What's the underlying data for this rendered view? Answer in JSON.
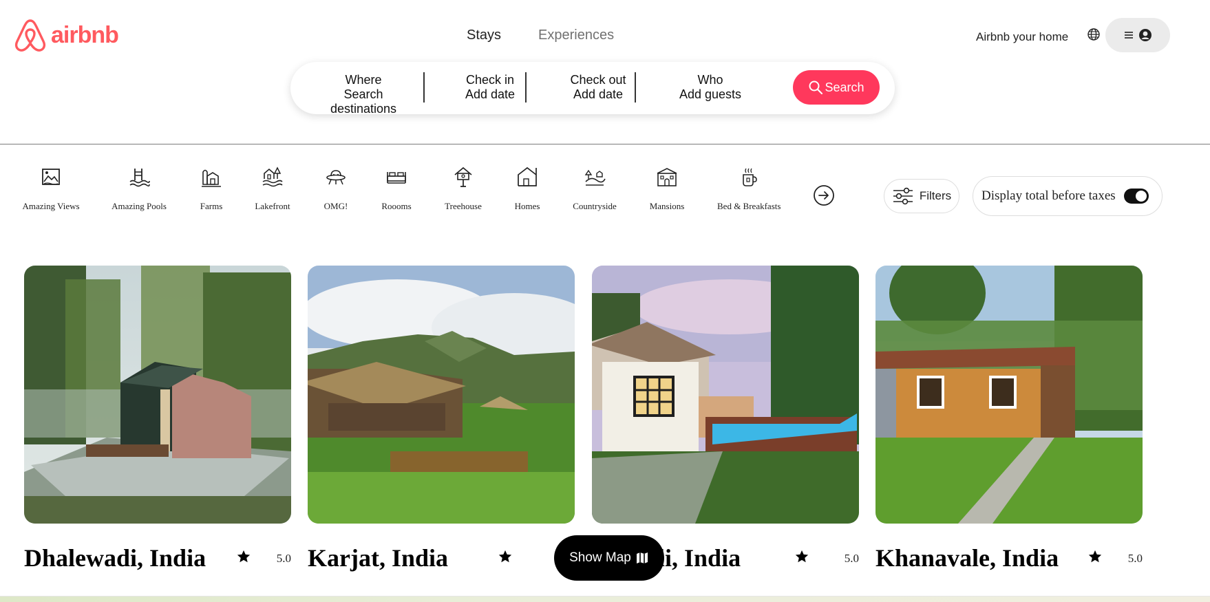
{
  "brand": {
    "name": "airbnb",
    "color": "#ff5a5f"
  },
  "top_tabs": [
    {
      "label": "Stays",
      "active": true
    },
    {
      "label": "Experiences",
      "active": false
    }
  ],
  "right_nav": {
    "host_link": "Airbnb your home",
    "globe_icon": "globe-icon",
    "menu_icon": "hamburger-icon",
    "profile_icon": "user-circle-icon"
  },
  "search": {
    "where": {
      "label": "Where",
      "value": "Search destinations"
    },
    "check_in": {
      "label": "Check in",
      "value": "Add date"
    },
    "check_out": {
      "label": "Check out",
      "value": "Add date"
    },
    "who": {
      "label": "Who",
      "value": "Add guests"
    },
    "button_label": "Search",
    "button_color": "#ff385c"
  },
  "categories": [
    {
      "label": "Amazing Views",
      "icon": "amazing-views-icon"
    },
    {
      "label": "Amazing Pools",
      "icon": "amazing-pools-icon"
    },
    {
      "label": "Farms",
      "icon": "farms-icon"
    },
    {
      "label": "Lakefront",
      "icon": "lakefront-icon"
    },
    {
      "label": "OMG!",
      "icon": "omg-icon"
    },
    {
      "label": "Roooms",
      "icon": "rooms-icon"
    },
    {
      "label": "Treehouse",
      "icon": "treehouse-icon"
    },
    {
      "label": "Homes",
      "icon": "homes-icon"
    },
    {
      "label": "Countryside",
      "icon": "countryside-icon"
    },
    {
      "label": "Mansions",
      "icon": "mansions-icon"
    },
    {
      "label": "Bed & Breakfasts",
      "icon": "bed-breakfasts-icon"
    }
  ],
  "filters": {
    "label": "Filters"
  },
  "taxes_toggle": {
    "label": "Display total before taxes",
    "on": true
  },
  "listings": [
    {
      "title": "Dhalewadi, India",
      "rating": "5.0"
    },
    {
      "title": "Karjat, India",
      "rating": ""
    },
    {
      "title": "Kasheli, India",
      "rating": "5.0"
    },
    {
      "title": "Khanavale, India",
      "rating": "5.0"
    }
  ],
  "show_map": {
    "label": "Show Map"
  }
}
